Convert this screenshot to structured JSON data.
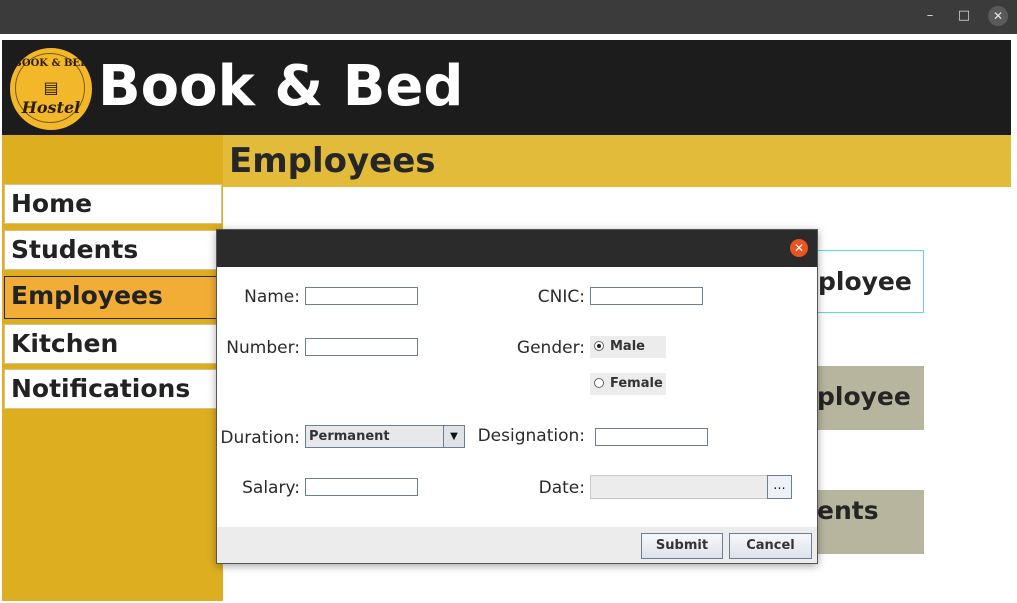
{
  "window": {
    "minimize_glyph": "–",
    "maximize_glyph": "□",
    "close_glyph": "✕"
  },
  "app": {
    "title": "Book & Bed",
    "logo": {
      "top": "BOOK & BED",
      "script": "Hostel"
    }
  },
  "sidebar": {
    "items": [
      {
        "label": "Home"
      },
      {
        "label": "Students"
      },
      {
        "label": "Employees",
        "active": true
      },
      {
        "label": "Kitchen"
      },
      {
        "label": "Notifications"
      }
    ]
  },
  "section": {
    "title": "Employees"
  },
  "background_buttons": {
    "b1": "ployee",
    "b2": "ployee",
    "b3": "ents"
  },
  "dialog": {
    "close_glyph": "✕",
    "fields": {
      "name": {
        "label": "Name:",
        "value": ""
      },
      "cnic": {
        "label": "CNIC:",
        "value": ""
      },
      "number": {
        "label": "Number:",
        "value": ""
      },
      "gender": {
        "label": "Gender:",
        "options": [
          "Male",
          "Female"
        ],
        "selected": "Male"
      },
      "duration": {
        "label": "Duration:",
        "value": "Permanent"
      },
      "designation": {
        "label": "Designation:",
        "value": ""
      },
      "salary": {
        "label": "Salary:",
        "value": ""
      },
      "date": {
        "label": "Date:",
        "value": "",
        "button": "..."
      }
    },
    "submit_label": "Submit",
    "cancel_label": "Cancel"
  },
  "colors": {
    "header": "#1d1c1c",
    "sidebar": "#ddae20",
    "section_bar": "#e2bb3a",
    "active_nav": "#f2ad36",
    "dialog_close": "#e95420"
  }
}
